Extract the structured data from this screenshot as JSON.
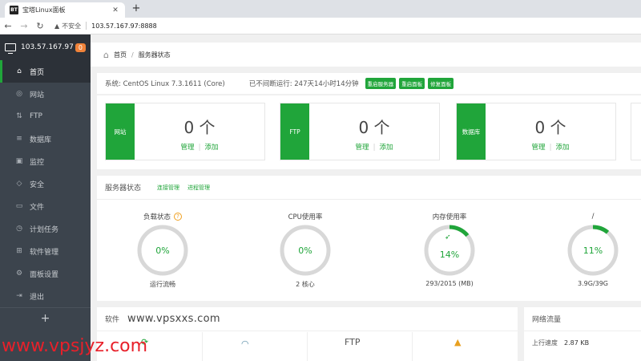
{
  "browser": {
    "tab_title": "宝塔Linux面板",
    "favicon_text": "BT",
    "insecure_label": "不安全",
    "url": "103.57.167.97:8888"
  },
  "sidebar": {
    "ip": "103.57.167.97",
    "badge": "0",
    "items": [
      {
        "label": "首页",
        "icon": "home-icon"
      },
      {
        "label": "网站",
        "icon": "globe-icon"
      },
      {
        "label": "FTP",
        "icon": "ftp-icon"
      },
      {
        "label": "数据库",
        "icon": "database-icon"
      },
      {
        "label": "监控",
        "icon": "monitor-icon"
      },
      {
        "label": "安全",
        "icon": "shield-icon"
      },
      {
        "label": "文件",
        "icon": "folder-icon"
      },
      {
        "label": "计划任务",
        "icon": "clock-icon"
      },
      {
        "label": "软件管理",
        "icon": "grid-icon"
      },
      {
        "label": "面板设置",
        "icon": "gear-icon"
      },
      {
        "label": "退出",
        "icon": "logout-icon"
      }
    ],
    "add_label": "+"
  },
  "breadcrumb": {
    "home": "首页",
    "current": "服务器状态"
  },
  "system": {
    "os": "系统: CentOS Linux 7.3.1611 (Core)",
    "uptime": "已不间断运行: 247天14小时14分钟",
    "buttons": [
      "重启服务器",
      "重启面板",
      "修复面板"
    ]
  },
  "stats": [
    {
      "label": "网站",
      "value": "0 个",
      "manage": "管理",
      "add": "添加"
    },
    {
      "label": "FTP",
      "value": "0 个",
      "manage": "管理",
      "add": "添加"
    },
    {
      "label": "数据库",
      "value": "0 个",
      "manage": "管理",
      "add": "添加"
    }
  ],
  "status": {
    "title": "服务器状态",
    "links": [
      "连接管理",
      "进程管理"
    ],
    "gauges": [
      {
        "title": "负载状态",
        "percent": "0%",
        "value": 0,
        "sub": "运行流畅",
        "help": "?"
      },
      {
        "title": "CPU使用率",
        "percent": "0%",
        "value": 0,
        "sub": "2 核心"
      },
      {
        "title": "内存使用率",
        "percent": "14%",
        "value": 14,
        "sub": "293/2015 (MB)"
      },
      {
        "title": "/",
        "percent": "11%",
        "value": 11,
        "sub": "3.9G/39G"
      }
    ]
  },
  "software": {
    "title": "软件",
    "watermark": "www.vpsxxs.com",
    "ftp_logo": "FTP"
  },
  "network": {
    "title": "网络流量",
    "up_label": "上行速度",
    "up_value": "2.87 KB"
  },
  "watermark_bottom": "www.vpsjyz.com",
  "colors": {
    "accent": "#20a53a",
    "sidebar": "#3c444d",
    "badge": "#f0833a",
    "ring_bg": "#d8d8d8"
  }
}
